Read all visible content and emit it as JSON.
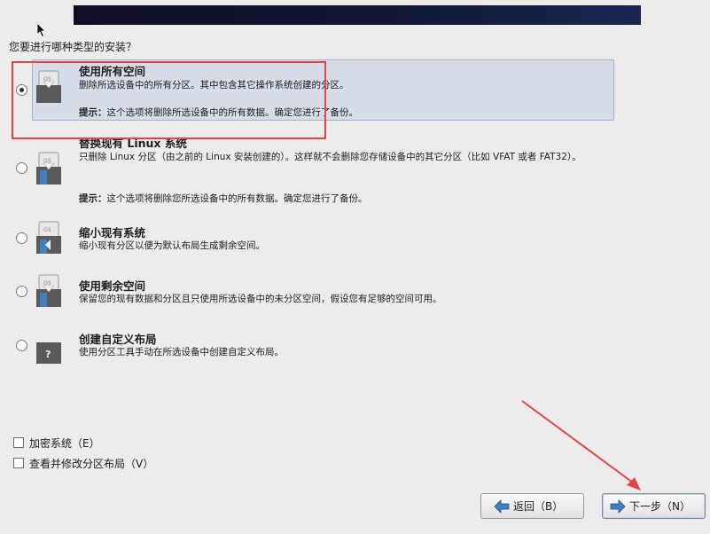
{
  "question": "您要进行哪种类型的安装？",
  "options": [
    {
      "title": "使用所有空间",
      "desc": "删除所选设备中的所有分区。其中包含其它操作系统创建的分区。",
      "hint_label": "提示：",
      "hint_text": "这个选项将删除所选设备中的所有数据。确定您进行了备份。",
      "selected": true,
      "icon": "disk-erase-icon"
    },
    {
      "title": "替换现有 Linux 系统",
      "desc": "只删除 Linux 分区（由之前的 Linux 安装创建的）。这样就不会删除您存储设备中的其它分区（比如 VFAT 或者 FAT32）。",
      "hint_label": "提示：",
      "hint_text": "这个选项将删除您所选设备中的所有数据。确定您进行了备份。",
      "selected": false,
      "icon": "disk-replace-icon"
    },
    {
      "title": "缩小现有系统",
      "desc": "缩小现有分区以便为默认布局生成剩余空间。",
      "selected": false,
      "icon": "disk-shrink-icon"
    },
    {
      "title": "使用剩余空间",
      "desc": "保留您的现有数据和分区且只使用所选设备中的未分区空间，假设您有足够的空间可用。",
      "selected": false,
      "icon": "disk-free-space-icon"
    },
    {
      "title": "创建自定义布局",
      "desc": "使用分区工具手动在所选设备中创建自定义布局。",
      "selected": false,
      "icon": "disk-custom-icon"
    }
  ],
  "checkboxes": {
    "encrypt": "加密系统（E）",
    "review": "查看并修改分区布局（V）"
  },
  "buttons": {
    "back": "返回（B）",
    "next": "下一步（N）"
  },
  "colors": {
    "annotation_red": "#e24545",
    "selection_bg": "#d7dde8",
    "banner": "#0d0f27"
  }
}
